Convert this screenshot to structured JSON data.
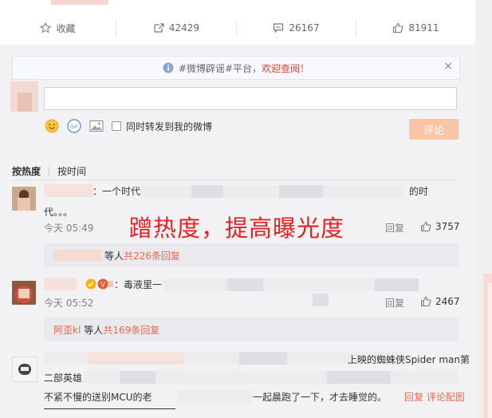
{
  "actions": {
    "favorite": "收藏",
    "repost": "42429",
    "comment": "26167",
    "like": "81911"
  },
  "notice": {
    "hashtag": "#微博辟谣#平台，",
    "highlight": "欢迎查阅！",
    "close": "×"
  },
  "composer": {
    "repost_option": "同时转发到我的微博",
    "submit": "评论"
  },
  "sort": {
    "by_hot": "按热度",
    "by_time": "按时间"
  },
  "comments": [
    {
      "text_start": "：一个时代",
      "text_end": "的时",
      "line2": "代。。。",
      "time": "今天 05:49",
      "reply": "回复",
      "likes": "3757",
      "sub_users": "等人",
      "sub_count": "共226条回复"
    },
    {
      "text_start": "：毒液里一",
      "time": "今天 05:52",
      "reply": "回复",
      "likes": "2467",
      "sub_user": "阿歪kl",
      "sub_users": "等人",
      "sub_count": "共169条回复"
    },
    {
      "text_end": "上映的蜘蛛侠Spider man第",
      "line2": "二部英雄",
      "line3_start": "不紧不慢的送别MCU的老",
      "line3_end": "一起晨跑了一下，才去睡觉的。",
      "actions": "回复 评论配图"
    }
  ],
  "overlay": "蹭热度，提高曝光度",
  "colors": {
    "accent": "#e86a4d",
    "overlay_red": "#e62020",
    "submit_bg": "#f9c5a6"
  }
}
